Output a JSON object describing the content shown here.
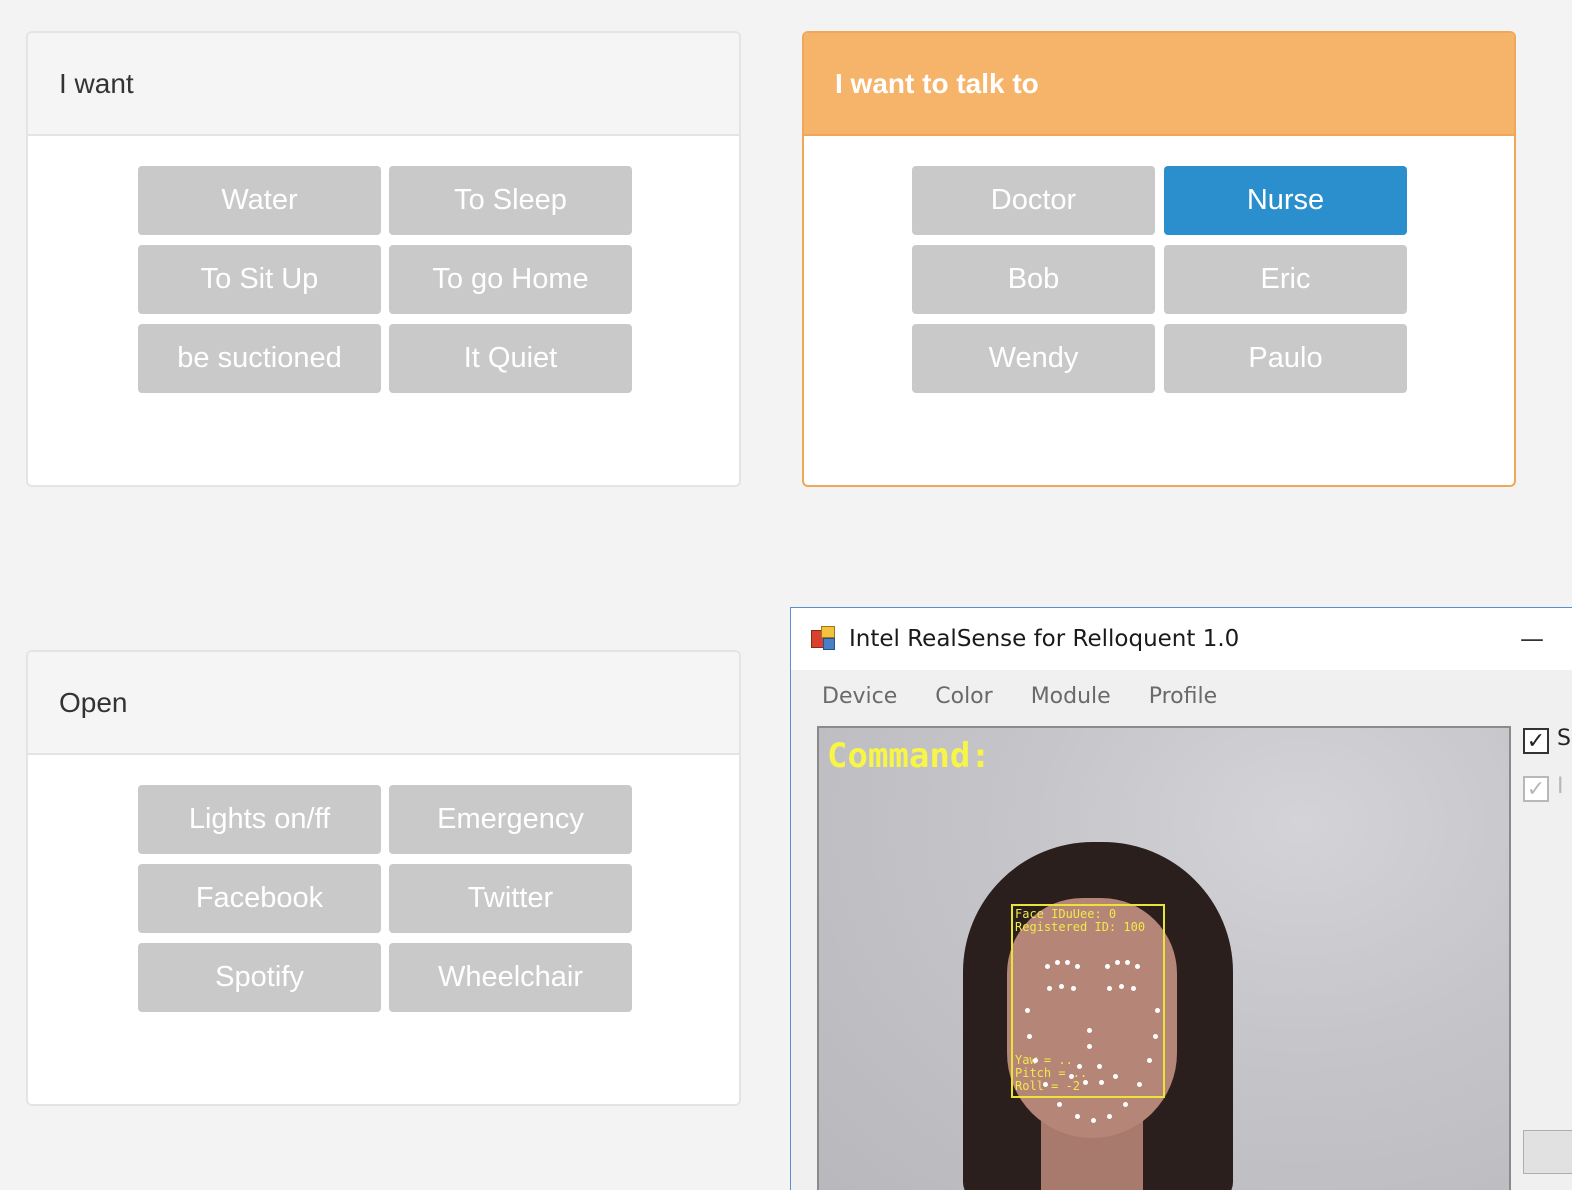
{
  "panels": {
    "i_want": {
      "title": "I want",
      "buttons": [
        "Water",
        "To Sleep",
        "To Sit Up",
        "To go Home",
        "be suctioned",
        "It Quiet"
      ]
    },
    "talk_to": {
      "title": "I want to talk to",
      "buttons": [
        "Doctor",
        "Nurse",
        "Bob",
        "Eric",
        "Wendy",
        "Paulo"
      ],
      "selected": "Nurse"
    },
    "open": {
      "title": "Open",
      "buttons": [
        "Lights on/ff",
        "Emergency",
        "Facebook",
        "Twitter",
        "Spotify",
        "Wheelchair"
      ]
    }
  },
  "realsense": {
    "title": "Intel RealSense for Relloquent 1.0",
    "minimize": "—",
    "menu": [
      "Device",
      "Color",
      "Module",
      "Profile"
    ],
    "overlay": {
      "command": "Command:",
      "face_info": "Face IDuUee: 0\nRegistered ID: 100",
      "pose_info": "Yaw = ..\nPitch = ..\nRoll = -2"
    },
    "side": {
      "checkbox1_checked": true,
      "checkbox1_label": "S",
      "checkbox2_checked": true,
      "checkbox2_label": "I"
    }
  },
  "colors": {
    "active_header": "#f6b36a",
    "selected_button": "#2b8fcd",
    "button": "#c9c9c9"
  }
}
